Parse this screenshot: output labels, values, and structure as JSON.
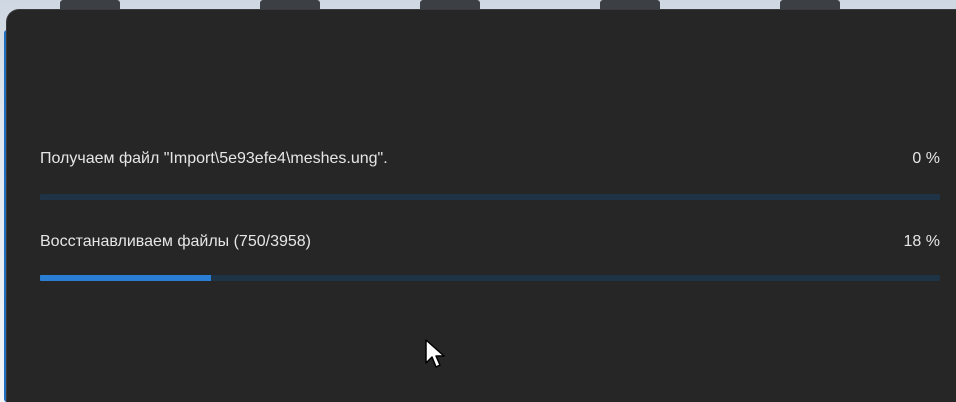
{
  "dialog": {
    "tasks": [
      {
        "label": "Получаем файл \"Import\\5e93efe4\\meshes.ung\".",
        "percent_text": "0 %",
        "progress": 0
      },
      {
        "label": "Восстанавливаем файлы (750/3958)",
        "percent_text": "18 %",
        "progress": 0.19
      }
    ]
  },
  "colors": {
    "dialog_bg": "#262626",
    "progress_track": "#1f3346",
    "progress_fill": "#2a7fd4",
    "text": "#e6e6e6"
  },
  "icons": {
    "cursor": "mouse-pointer-icon"
  }
}
